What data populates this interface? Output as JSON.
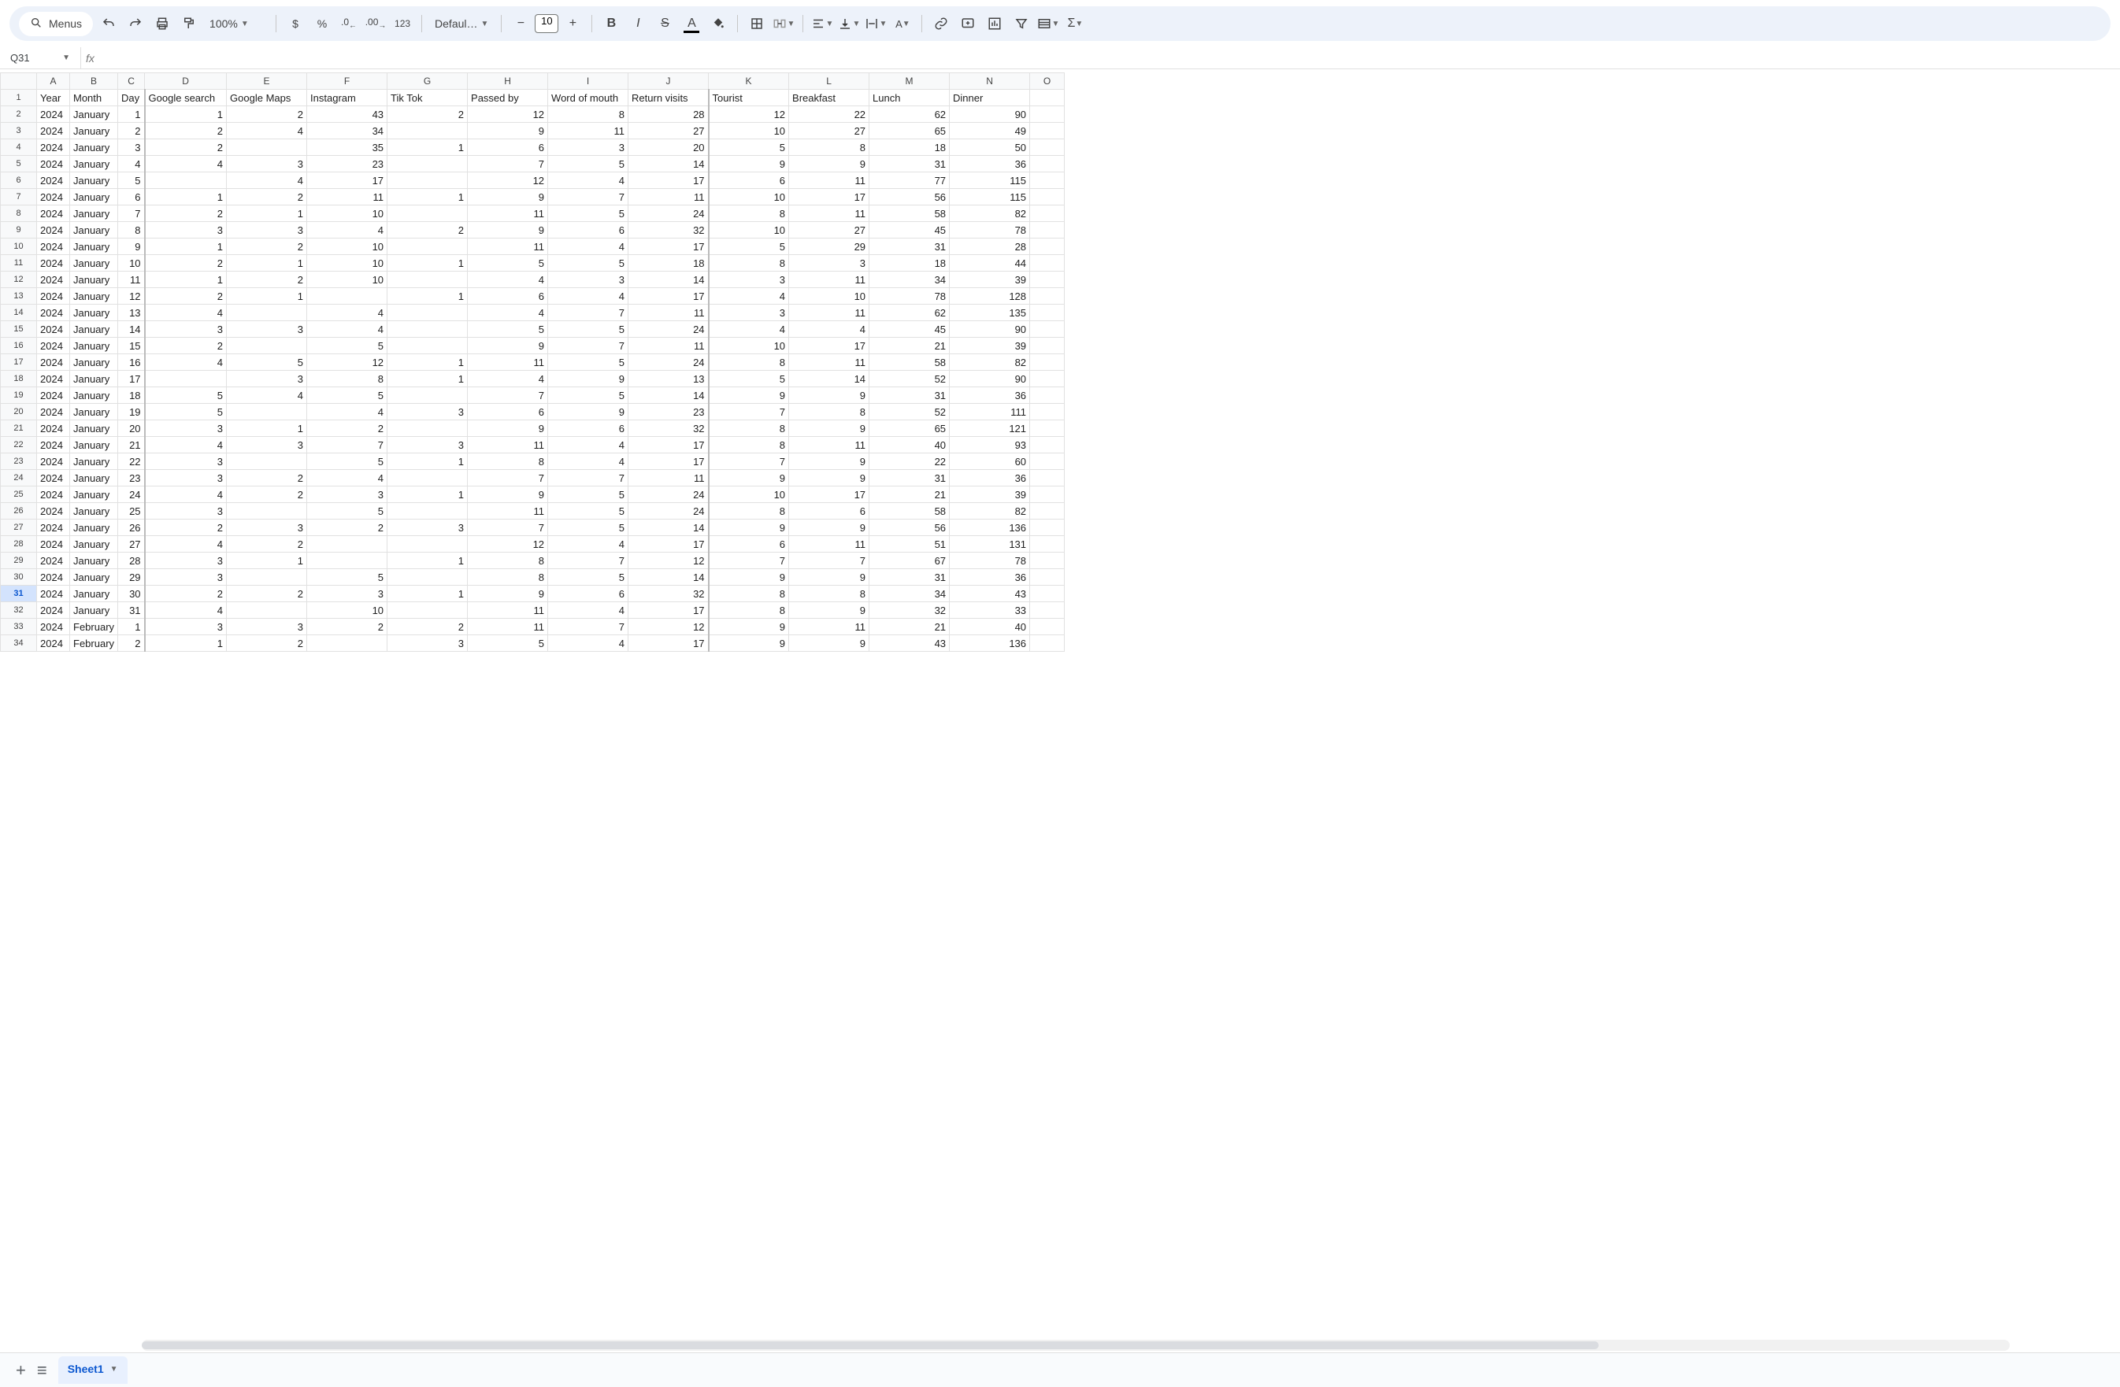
{
  "toolbar": {
    "menus_label": "Menus",
    "zoom": "100%",
    "font_family": "Defaul…",
    "font_size": "10"
  },
  "name_box": "Q31",
  "formula": "",
  "columns": [
    "A",
    "B",
    "C",
    "D",
    "E",
    "F",
    "G",
    "H",
    "I",
    "J",
    "K",
    "L",
    "M",
    "N",
    "O"
  ],
  "headers": [
    "Year",
    "Month",
    "Day",
    "Google search",
    "Google Maps",
    "Instagram",
    "Tik Tok",
    "Passed by",
    "Word of mouth",
    "Return visits",
    "Tourist",
    "Breakfast",
    "Lunch",
    "Dinner",
    ""
  ],
  "rows": [
    {
      "n": 1,
      "cells": [
        "Year",
        "Month",
        "Day",
        "Google search",
        "Google Maps",
        "Instagram",
        "Tik Tok",
        "Passed by",
        "Word of mouth",
        "Return visits",
        "Tourist",
        "Breakfast",
        "Lunch",
        "Dinner",
        ""
      ],
      "header": true
    },
    {
      "n": 2,
      "cells": [
        "2024",
        "January",
        "1",
        "1",
        "2",
        "43",
        "2",
        "12",
        "8",
        "28",
        "12",
        "22",
        "62",
        "90",
        ""
      ]
    },
    {
      "n": 3,
      "cells": [
        "2024",
        "January",
        "2",
        "2",
        "4",
        "34",
        "",
        "9",
        "11",
        "27",
        "10",
        "27",
        "65",
        "49",
        ""
      ]
    },
    {
      "n": 4,
      "cells": [
        "2024",
        "January",
        "3",
        "2",
        "",
        "35",
        "1",
        "6",
        "3",
        "20",
        "5",
        "8",
        "18",
        "50",
        ""
      ]
    },
    {
      "n": 5,
      "cells": [
        "2024",
        "January",
        "4",
        "4",
        "3",
        "23",
        "",
        "7",
        "5",
        "14",
        "9",
        "9",
        "31",
        "36",
        ""
      ]
    },
    {
      "n": 6,
      "cells": [
        "2024",
        "January",
        "5",
        "",
        "4",
        "17",
        "",
        "12",
        "4",
        "17",
        "6",
        "11",
        "77",
        "115",
        ""
      ]
    },
    {
      "n": 7,
      "cells": [
        "2024",
        "January",
        "6",
        "1",
        "2",
        "11",
        "1",
        "9",
        "7",
        "11",
        "10",
        "17",
        "56",
        "115",
        ""
      ]
    },
    {
      "n": 8,
      "cells": [
        "2024",
        "January",
        "7",
        "2",
        "1",
        "10",
        "",
        "11",
        "5",
        "24",
        "8",
        "11",
        "58",
        "82",
        ""
      ]
    },
    {
      "n": 9,
      "cells": [
        "2024",
        "January",
        "8",
        "3",
        "3",
        "4",
        "2",
        "9",
        "6",
        "32",
        "10",
        "27",
        "45",
        "78",
        ""
      ]
    },
    {
      "n": 10,
      "cells": [
        "2024",
        "January",
        "9",
        "1",
        "2",
        "10",
        "",
        "11",
        "4",
        "17",
        "5",
        "29",
        "31",
        "28",
        ""
      ]
    },
    {
      "n": 11,
      "cells": [
        "2024",
        "January",
        "10",
        "2",
        "1",
        "10",
        "1",
        "5",
        "5",
        "18",
        "8",
        "3",
        "18",
        "44",
        ""
      ]
    },
    {
      "n": 12,
      "cells": [
        "2024",
        "January",
        "11",
        "1",
        "2",
        "10",
        "",
        "4",
        "3",
        "14",
        "3",
        "11",
        "34",
        "39",
        ""
      ]
    },
    {
      "n": 13,
      "cells": [
        "2024",
        "January",
        "12",
        "2",
        "1",
        "",
        "1",
        "6",
        "4",
        "17",
        "4",
        "10",
        "78",
        "128",
        ""
      ]
    },
    {
      "n": 14,
      "cells": [
        "2024",
        "January",
        "13",
        "4",
        "",
        "4",
        "",
        "4",
        "7",
        "11",
        "3",
        "11",
        "62",
        "135",
        ""
      ]
    },
    {
      "n": 15,
      "cells": [
        "2024",
        "January",
        "14",
        "3",
        "3",
        "4",
        "",
        "5",
        "5",
        "24",
        "4",
        "4",
        "45",
        "90",
        ""
      ]
    },
    {
      "n": 16,
      "cells": [
        "2024",
        "January",
        "15",
        "2",
        "",
        "5",
        "",
        "9",
        "7",
        "11",
        "10",
        "17",
        "21",
        "39",
        ""
      ]
    },
    {
      "n": 17,
      "cells": [
        "2024",
        "January",
        "16",
        "4",
        "5",
        "12",
        "1",
        "11",
        "5",
        "24",
        "8",
        "11",
        "58",
        "82",
        ""
      ]
    },
    {
      "n": 18,
      "cells": [
        "2024",
        "January",
        "17",
        "",
        "3",
        "8",
        "1",
        "4",
        "9",
        "13",
        "5",
        "14",
        "52",
        "90",
        ""
      ]
    },
    {
      "n": 19,
      "cells": [
        "2024",
        "January",
        "18",
        "5",
        "4",
        "5",
        "",
        "7",
        "5",
        "14",
        "9",
        "9",
        "31",
        "36",
        ""
      ]
    },
    {
      "n": 20,
      "cells": [
        "2024",
        "January",
        "19",
        "5",
        "",
        "4",
        "3",
        "6",
        "9",
        "23",
        "7",
        "8",
        "52",
        "111",
        ""
      ]
    },
    {
      "n": 21,
      "cells": [
        "2024",
        "January",
        "20",
        "3",
        "1",
        "2",
        "",
        "9",
        "6",
        "32",
        "8",
        "9",
        "65",
        "121",
        ""
      ]
    },
    {
      "n": 22,
      "cells": [
        "2024",
        "January",
        "21",
        "4",
        "3",
        "7",
        "3",
        "11",
        "4",
        "17",
        "8",
        "11",
        "40",
        "93",
        ""
      ]
    },
    {
      "n": 23,
      "cells": [
        "2024",
        "January",
        "22",
        "3",
        "",
        "5",
        "1",
        "8",
        "4",
        "17",
        "7",
        "9",
        "22",
        "60",
        ""
      ]
    },
    {
      "n": 24,
      "cells": [
        "2024",
        "January",
        "23",
        "3",
        "2",
        "4",
        "",
        "7",
        "7",
        "11",
        "9",
        "9",
        "31",
        "36",
        ""
      ]
    },
    {
      "n": 25,
      "cells": [
        "2024",
        "January",
        "24",
        "4",
        "2",
        "3",
        "1",
        "9",
        "5",
        "24",
        "10",
        "17",
        "21",
        "39",
        ""
      ]
    },
    {
      "n": 26,
      "cells": [
        "2024",
        "January",
        "25",
        "3",
        "",
        "5",
        "",
        "11",
        "5",
        "24",
        "8",
        "6",
        "58",
        "82",
        ""
      ]
    },
    {
      "n": 27,
      "cells": [
        "2024",
        "January",
        "26",
        "2",
        "3",
        "2",
        "3",
        "7",
        "5",
        "14",
        "9",
        "9",
        "56",
        "136",
        ""
      ]
    },
    {
      "n": 28,
      "cells": [
        "2024",
        "January",
        "27",
        "4",
        "2",
        "",
        "",
        "12",
        "4",
        "17",
        "6",
        "11",
        "51",
        "131",
        ""
      ]
    },
    {
      "n": 29,
      "cells": [
        "2024",
        "January",
        "28",
        "3",
        "1",
        "",
        "1",
        "8",
        "7",
        "12",
        "7",
        "7",
        "67",
        "78",
        ""
      ]
    },
    {
      "n": 30,
      "cells": [
        "2024",
        "January",
        "29",
        "3",
        "",
        "5",
        "",
        "8",
        "5",
        "14",
        "9",
        "9",
        "31",
        "36",
        ""
      ]
    },
    {
      "n": 31,
      "cells": [
        "2024",
        "January",
        "30",
        "2",
        "2",
        "3",
        "1",
        "9",
        "6",
        "32",
        "8",
        "8",
        "34",
        "43",
        ""
      ]
    },
    {
      "n": 32,
      "cells": [
        "2024",
        "January",
        "31",
        "4",
        "",
        "10",
        "",
        "11",
        "4",
        "17",
        "8",
        "9",
        "32",
        "33",
        ""
      ]
    },
    {
      "n": 33,
      "cells": [
        "2024",
        "February",
        "1",
        "3",
        "3",
        "2",
        "2",
        "11",
        "7",
        "12",
        "9",
        "11",
        "21",
        "40",
        ""
      ]
    },
    {
      "n": 34,
      "cells": [
        "2024",
        "February",
        "2",
        "1",
        "2",
        "",
        "3",
        "5",
        "4",
        "17",
        "9",
        "9",
        "43",
        "136",
        ""
      ]
    }
  ],
  "active_row": 31,
  "sheet_tab": "Sheet1"
}
